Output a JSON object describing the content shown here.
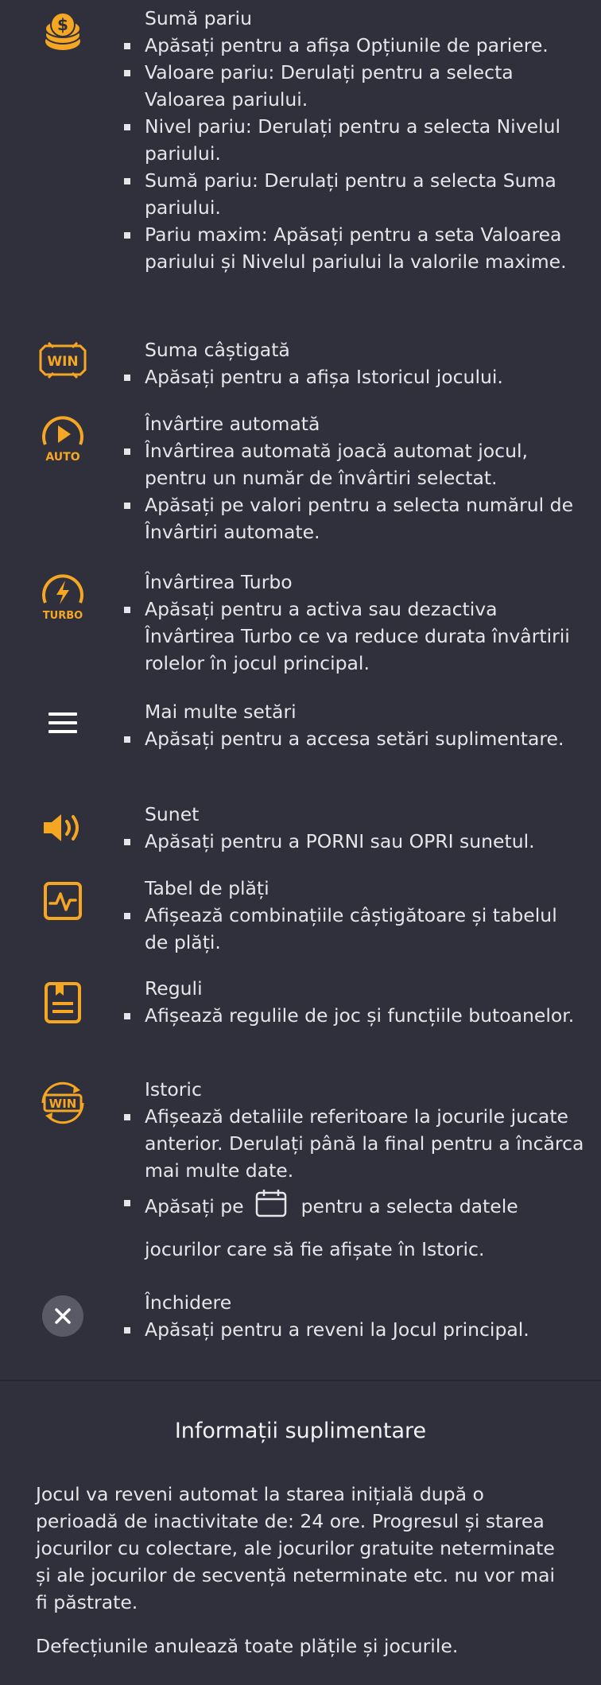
{
  "colors": {
    "background": "#30303d",
    "accent": "#f5a623",
    "text": "#e6e6ea"
  },
  "items": [
    {
      "icon": "coin-stack-icon",
      "title": "Sumă pariu",
      "bullets": [
        "Apăsați pentru a afișa Opțiunile de pariere.",
        "Valoare pariu: Derulați pentru a selecta Valoarea pariului.",
        "Nivel pariu: Derulați pentru a selecta Nivelul pariului.",
        "Sumă pariu: Derulați pentru a selecta Suma pariului.",
        "Pariu maxim: Apăsați pentru a seta Valoarea pariului și Nivelul pariului la valorile maxime."
      ]
    },
    {
      "icon": "win-icon",
      "title": "Suma câștigată",
      "bullets": [
        "Apăsați pentru a afișa Istoricul jocului."
      ]
    },
    {
      "icon": "autoplay-icon",
      "icon_label": "AUTO",
      "title": "Învârtire automată",
      "bullets": [
        "Învârtirea automată joacă automat jocul, pentru un număr de învârtiri selectat.",
        "Apăsați pe valori pentru a selecta numărul de Învârtiri automate."
      ]
    },
    {
      "icon": "turbo-icon",
      "icon_label": "TURBO",
      "title": "Învârtirea Turbo",
      "bullets": [
        "Apăsați pentru a activa sau dezactiva Învârtirea Turbo ce va reduce durata învârtirii rolelor în jocul principal."
      ]
    },
    {
      "icon": "menu-icon",
      "title": "Mai multe setări",
      "bullets": [
        "Apăsați pentru a accesa setări suplimentare."
      ]
    },
    {
      "icon": "speaker-icon",
      "title": "Sunet",
      "bullets": [
        "Apăsați pentru a PORNI sau OPRI sunetul."
      ]
    },
    {
      "icon": "paytable-icon",
      "title": "Tabel de plăți",
      "bullets": [
        "Afișează combinațiile câștigătoare și tabelul de plăți."
      ]
    },
    {
      "icon": "rules-icon",
      "title": "Reguli",
      "bullets": [
        "Afișează regulile de joc și funcțiile butoanelor."
      ]
    },
    {
      "icon": "history-icon",
      "title": "Istoric",
      "bullets": [
        "Afișează detaliile referitoare la jocurile jucate anterior. Derulați până la final pentru a încărca mai multe date."
      ],
      "date_bullet": {
        "before": "Apăsați pe",
        "after": "pentru a selecta datele",
        "second_line": "jocurilor care să fie afișate în Istoric.",
        "icon": "calendar-icon"
      }
    },
    {
      "icon": "close-icon",
      "title": "Închidere",
      "bullets": [
        "Apăsați pentru a reveni la Jocul principal."
      ]
    }
  ],
  "win_label": "WIN",
  "info": {
    "title": "Informații suplimentare",
    "paragraph1": "Jocul va reveni automat la starea inițială după o perioadă de inactivitate de: 24 ore. Progresul și starea jocurilor cu colectare, ale jocurilor gratuite neterminate și ale jocurilor de secvență neterminate etc. nu vor mai fi păstrate.",
    "paragraph2": "Defecțiunile anulează toate plățile și jocurile."
  }
}
